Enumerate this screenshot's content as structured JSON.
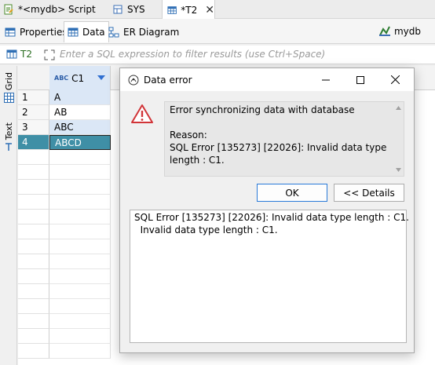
{
  "editor_tabs": [
    {
      "label": "*<mydb> Script",
      "icon": "sql-script-icon"
    },
    {
      "label": "SYS",
      "icon": "schema-icon"
    },
    {
      "label": "*T2",
      "icon": "table-icon",
      "active": true
    }
  ],
  "sub_tabs": [
    {
      "label": "Properties",
      "icon": "properties-icon"
    },
    {
      "label": "Data",
      "icon": "data-icon",
      "active": true
    },
    {
      "label": "ER Diagram",
      "icon": "er-diagram-icon"
    }
  ],
  "connection": {
    "label": "mydb",
    "icon": "database-connection-icon"
  },
  "filter": {
    "table_label": "T2",
    "placeholder": "Enter a SQL expression to filter results (use Ctrl+Space)"
  },
  "side_tabs": [
    {
      "label": "Grid",
      "icon": "grid-icon"
    },
    {
      "label": "Text",
      "icon": "text-icon"
    }
  ],
  "grid": {
    "column": {
      "type_badge": "ABC",
      "name": "C1"
    },
    "rows": [
      {
        "num": "1",
        "value": "A"
      },
      {
        "num": "2",
        "value": "AB"
      },
      {
        "num": "3",
        "value": "ABC"
      },
      {
        "num": "4",
        "value": "ABCD"
      }
    ]
  },
  "dialog": {
    "title": "Data error",
    "message_lines": [
      "Error synchronizing data with database",
      "",
      "Reason:",
      "SQL Error [135273] [22026]: Invalid data type",
      "length : C1."
    ],
    "ok_label": "OK",
    "details_label": "<< Details",
    "details_lines": [
      "SQL Error [135273] [22026]: Invalid data type length : C1.",
      "  Invalid data type length : C1."
    ]
  },
  "colors": {
    "accent": "#2a7ad8",
    "error_red": "#d13438",
    "selected_row": "#3f8fa6",
    "header_selected": "#dbe7f6"
  }
}
